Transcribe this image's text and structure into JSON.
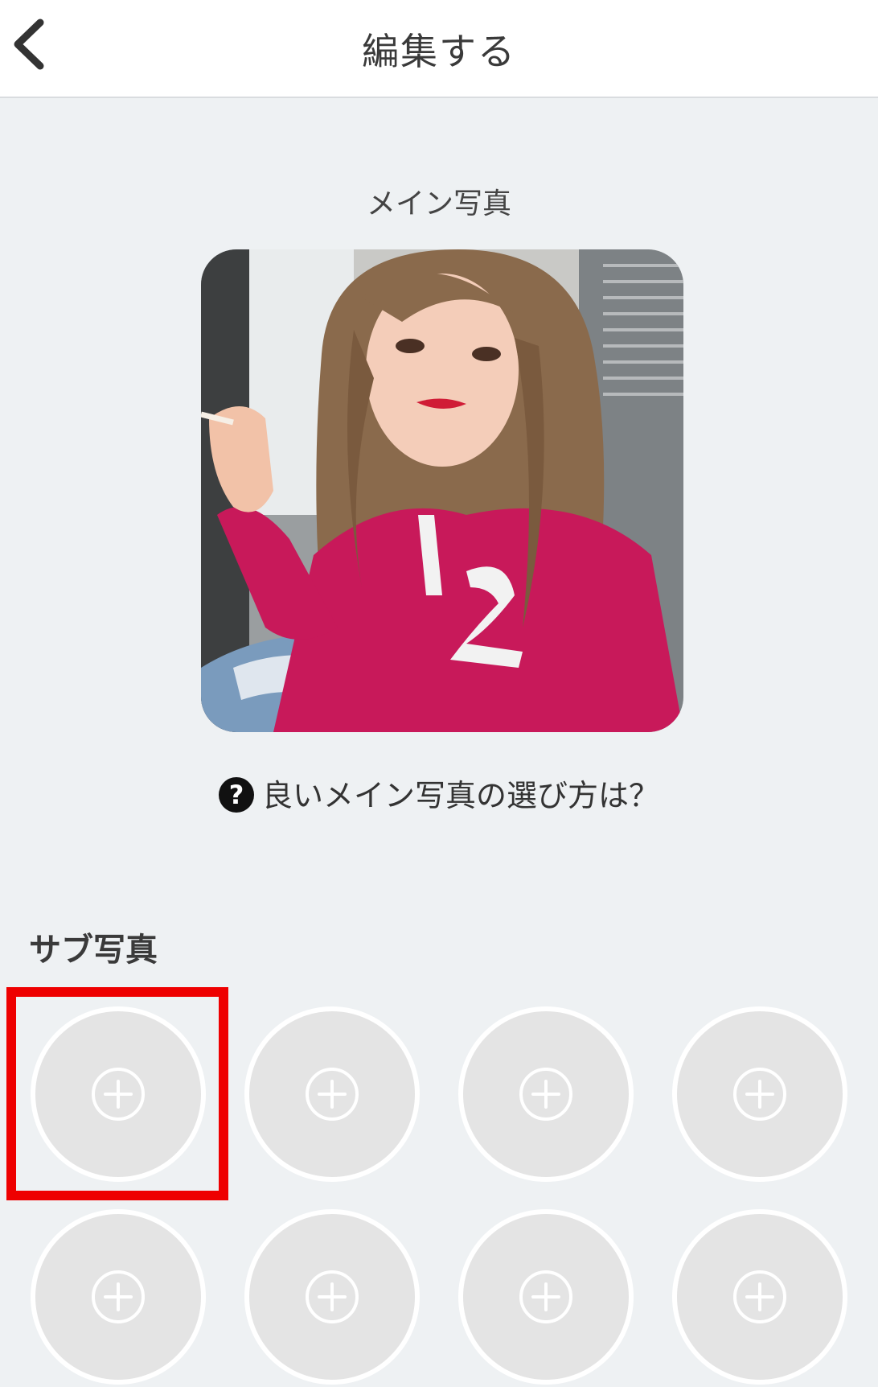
{
  "header": {
    "title": "編集する",
    "back_icon": "chevron-left-icon"
  },
  "main_photo": {
    "label": "メイン写真",
    "subject": "woman with long light-brown hair in a magenta sweatshirt holding a cigarette"
  },
  "help_link": {
    "icon": "question-circle-icon",
    "text": "良いメイン写真の選び方は？"
  },
  "sub_photos": {
    "label": "サブ写真",
    "slots": [
      {
        "icon": "plus-circle-icon",
        "highlighted": true
      },
      {
        "icon": "plus-circle-icon"
      },
      {
        "icon": "plus-circle-icon"
      },
      {
        "icon": "plus-circle-icon"
      },
      {
        "icon": "plus-circle-icon"
      },
      {
        "icon": "plus-circle-icon"
      },
      {
        "icon": "plus-circle-icon"
      },
      {
        "icon": "plus-circle-icon"
      }
    ]
  },
  "colors": {
    "background": "#eef1f3",
    "header_bg": "#ffffff",
    "slot_fill": "#e4e4e4",
    "slot_border": "#ffffff",
    "highlight": "#ee0000"
  }
}
